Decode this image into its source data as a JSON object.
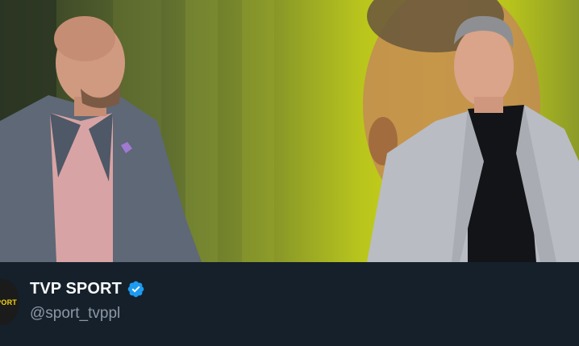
{
  "media": {
    "description_icon": "video-frame",
    "colors": {
      "accent_green": "#cfd712"
    }
  },
  "profile": {
    "avatar_text": "SPORT",
    "name": "TVP SPORT",
    "handle": "@sport_tvppl",
    "verified_icon": "verified-badge-icon",
    "verified_color": "#1d9bf0"
  }
}
